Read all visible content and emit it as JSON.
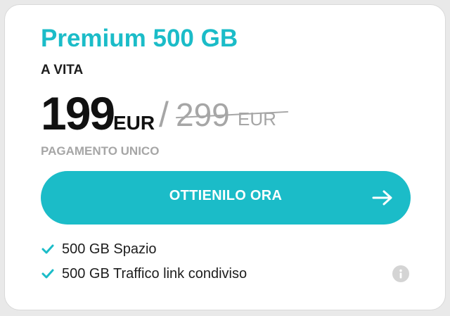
{
  "plan": {
    "title": "Premium 500 GB",
    "subtitle": "A VITA",
    "price": "199",
    "price_currency": "EUR",
    "separator": "/",
    "old_price": "299",
    "old_price_currency": "EUR",
    "payment_note": "PAGAMENTO UNICO"
  },
  "cta": {
    "label": "OTTIENILO ORA",
    "icon": "arrow-right-icon"
  },
  "features": [
    {
      "label": "500 GB Spazio",
      "icon": "check-icon"
    },
    {
      "label": "500 GB Traffico link condiviso",
      "icon": "check-icon",
      "info_icon": "info-icon"
    }
  ],
  "colors": {
    "accent": "#1bbcc8",
    "text": "#1d1d1d",
    "muted": "#a6a6a6",
    "background": "#ffffff"
  }
}
